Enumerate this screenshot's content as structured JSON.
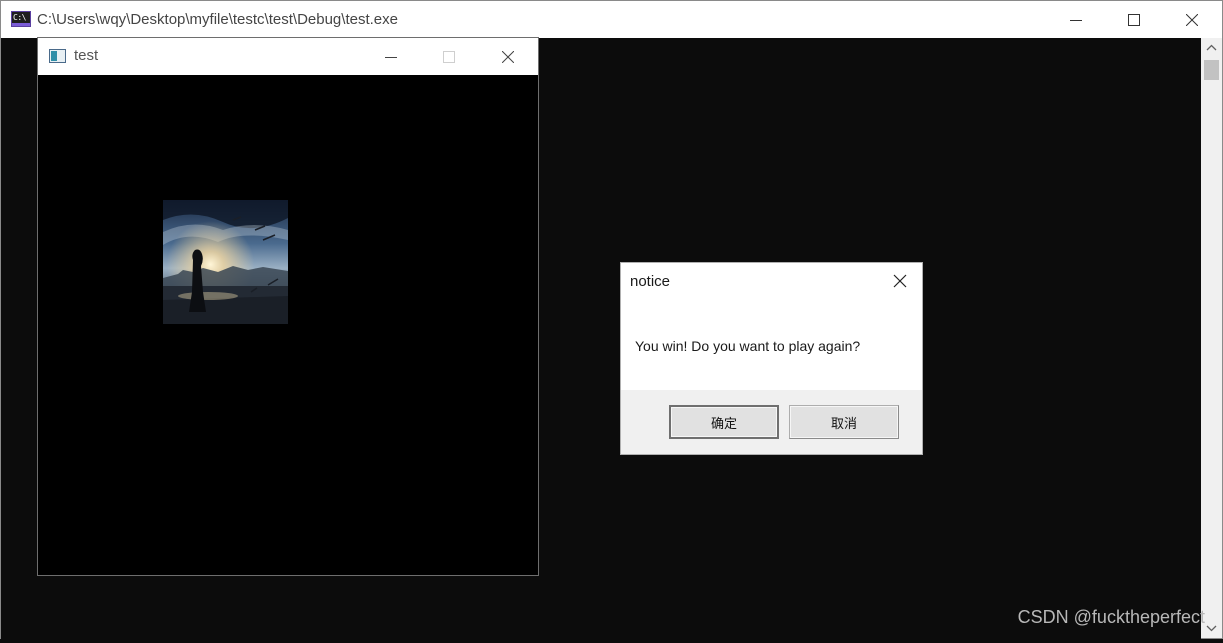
{
  "console": {
    "title": "C:\\Users\\wqy\\Desktop\\myfile\\testc\\test\\Debug\\test.exe",
    "icon": "console-app-icon",
    "icon_glyph": "C:\\"
  },
  "game_window": {
    "title": "test",
    "icon": "window-app-icon",
    "picture": "anime-girl-under-night-sky-image"
  },
  "dialog": {
    "title": "notice",
    "message": "You win! Do you want to play again?",
    "ok_label": "确定",
    "cancel_label": "取消"
  },
  "watermark": "CSDN @fucktheperfect",
  "colors": {
    "console_background": "#0c0c0c",
    "titlebar": "#ffffff",
    "dialog_footer": "#f0f0f0",
    "button_face": "#e1e1e1"
  }
}
